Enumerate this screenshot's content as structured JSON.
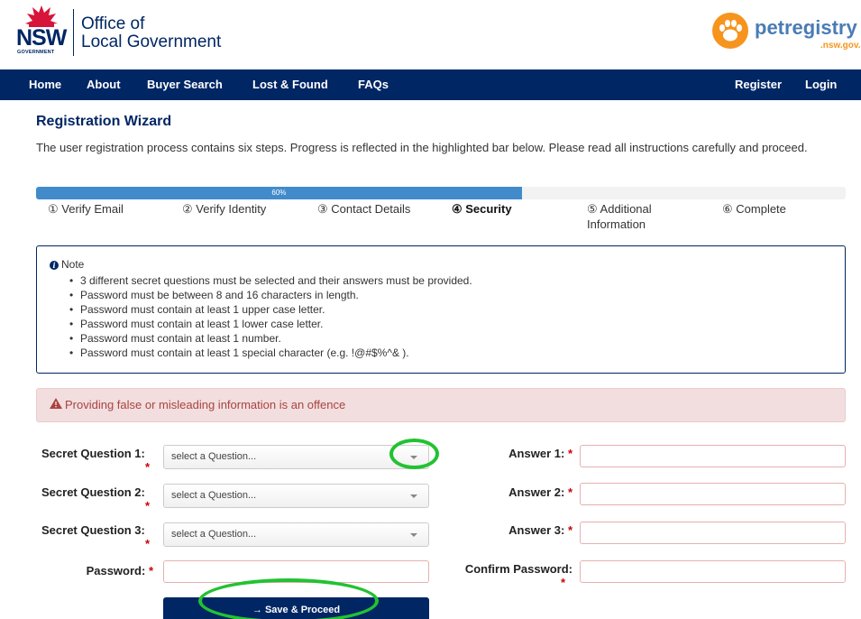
{
  "header": {
    "nsw_text": "NSW",
    "nsw_sub": "GOVERNMENT",
    "olg_line1": "Office of",
    "olg_line2": "Local Government",
    "pet_name": "petregistry",
    "pet_domain": ".nsw.gov.au"
  },
  "nav": {
    "left": [
      "Home",
      "About",
      "Buyer Search",
      "Lost & Found",
      "FAQs"
    ],
    "right": [
      "Register",
      "Login"
    ]
  },
  "wizard": {
    "title": "Registration Wizard",
    "intro": "The user registration process contains six steps. Progress is reflected in the highlighted bar below. Please read all instructions carefully and proceed.",
    "progress_label": "60%",
    "progress_value": 0.6,
    "steps": [
      "① Verify Email",
      "② Verify Identity",
      "③ Contact Details",
      "④ Security",
      "⑤ Additional Information",
      "⑥ Complete"
    ],
    "active_step": 3
  },
  "note": {
    "heading": "Note",
    "items": [
      "3 different secret questions must be selected and their answers must be provided.",
      "Password must be between 8 and 16 characters in length.",
      "Password must contain at least 1 upper case letter.",
      "Password must contain at least 1 lower case letter.",
      "Password must contain at least 1 number.",
      "Password must contain at least 1 special character (e.g. !@#$%^& )."
    ]
  },
  "alert": {
    "text": "Providing false or misleading information is an offence"
  },
  "form": {
    "q1_label": "Secret Question 1:",
    "q2_label": "Secret Question 2:",
    "q3_label": "Secret Question 3:",
    "select_placeholder": "select a Question...",
    "a1_label": "Answer 1:",
    "a2_label": "Answer 2:",
    "a3_label": "Answer 3:",
    "password_label": "Password:",
    "confirm_label": "Confirm Password:",
    "required_mark": "*",
    "save_button": "→ Save & Proceed"
  },
  "colors": {
    "navy": "#002664",
    "progress": "#428bca",
    "alert_bg": "#f2dede",
    "alert_text": "#a94442",
    "highlight": "#22c232",
    "pet_orange": "#f7941d"
  }
}
